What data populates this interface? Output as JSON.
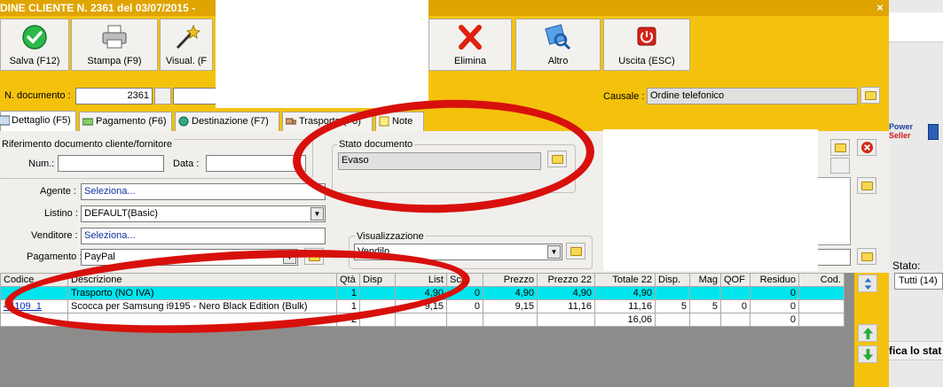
{
  "window": {
    "title": "DINE CLIENTE N. 2361 del 03/07/2015 -",
    "close_glyph": "×"
  },
  "toolbar": {
    "buttons": [
      {
        "label": "Salva (F12)",
        "icon": "check-icon"
      },
      {
        "label": "Stampa (F9)",
        "icon": "printer-icon"
      },
      {
        "label": "Visual. (F",
        "icon": "magic-wand-icon"
      },
      {
        "label": "Elimina",
        "icon": "red-x-icon"
      },
      {
        "label": "Altro",
        "icon": "magnifier-icon"
      },
      {
        "label": "Uscita (ESC)",
        "icon": "power-icon"
      }
    ]
  },
  "header": {
    "doc_number_label": "N. documento :",
    "doc_number": "2361",
    "causale_label": "Causale :",
    "causale": "Ordine telefonico"
  },
  "tabs": [
    {
      "label": "Dettaglio (F5)",
      "active": true
    },
    {
      "label": "Pagamento (F6)"
    },
    {
      "label": "Destinazione (F7)"
    },
    {
      "label": "Trasporto (F8)"
    },
    {
      "label": "Note"
    }
  ],
  "riferimento": {
    "title": "Riferimento documento cliente/fornitore",
    "num_label": "Num.:",
    "num_value": "",
    "data_label": "Data :",
    "data_value": ""
  },
  "stato_documento": {
    "title": "Stato documento",
    "value": "Evaso"
  },
  "form": {
    "agente_label": "Agente :",
    "agente_value": "Seleziona...",
    "listino_label": "Listino :",
    "listino_value": "DEFAULT(Basic)",
    "venditore_label": "Venditore :",
    "venditore_value": "Seleziona...",
    "pagamento_label": "Pagamento :",
    "pagamento_value": "PayPal"
  },
  "visualizzazione": {
    "title": "Visualizzazione",
    "value": "Vendilo"
  },
  "grid": {
    "columns": [
      "Codice",
      "Descrizione",
      "Qtà",
      "Disp",
      "List",
      "Sc",
      "Prezzo",
      "Prezzo 22",
      "Totale 22",
      "Disp.",
      "Mag",
      "QOF",
      "Residuo",
      "Cod."
    ],
    "rows": [
      {
        "codice": "",
        "descrizione": "Trasporto (NO IVA)",
        "qta": "1",
        "disp": "",
        "list": "4,90",
        "sc": "0",
        "prezzo": "4,90",
        "prezzo22": "4,90",
        "totale22": "4,90",
        "disp2": "",
        "mag": "",
        "qof": "",
        "residuo": "0",
        "cod": ""
      },
      {
        "codice": "44109_1",
        "descrizione": "Scocca per Samsung i9195 - Nero Black Edition (Bulk)",
        "qta": "1",
        "disp": "",
        "list": "9,15",
        "sc": "0",
        "prezzo": "9,15",
        "prezzo22": "11,16",
        "totale22": "11,16",
        "disp2": "5",
        "mag": "5",
        "qof": "0",
        "residuo": "0",
        "cod": ""
      },
      {
        "codice": "",
        "descrizione": "",
        "qta": "2",
        "disp": "",
        "list": "",
        "sc": "",
        "prezzo": "",
        "prezzo22": "",
        "totale22": "16,06",
        "disp2": "",
        "mag": "",
        "qof": "",
        "residuo": "0",
        "cod": ""
      }
    ]
  },
  "right_side": {
    "brand_power": "Power",
    "brand_seller": "Seller",
    "stato_label": "Stato:",
    "stato_value": "Tutti (14)",
    "bottom_text": "fica lo stat"
  },
  "colors": {
    "window_bg": "#f4c20d",
    "selected_row": "#00e5ee",
    "annotation": "#d8100c"
  }
}
